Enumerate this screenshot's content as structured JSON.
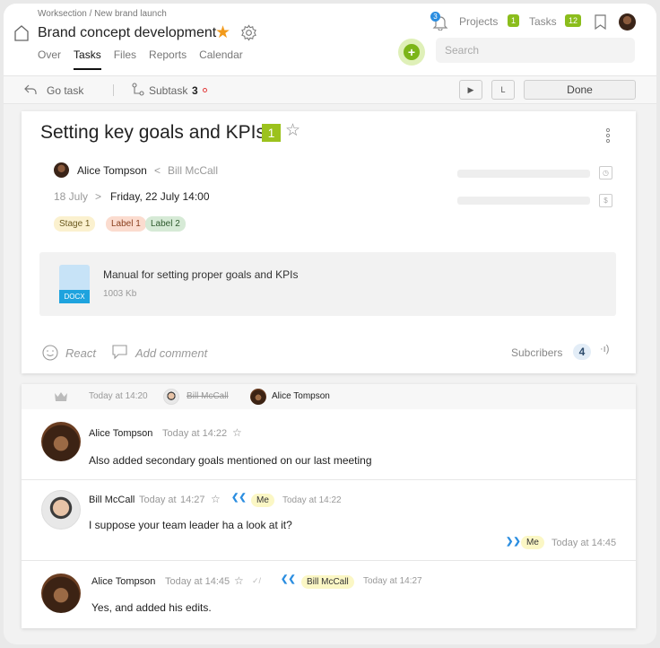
{
  "header": {
    "breadcrumb": "Worksection / New brand launch",
    "project_title": "Brand concept development",
    "nav": [
      "Over",
      "Tasks",
      "Files",
      "Reports",
      "Calendar"
    ],
    "notifications_count": "3",
    "projects_label": "Projects",
    "projects_count": "1",
    "tasks_label": "Tasks",
    "tasks_count": "12",
    "add_button": "+",
    "search_placeholder": "Search"
  },
  "toolbar": {
    "go_task": "Go task",
    "subtask_label": "Subtask",
    "subtask_count": "3",
    "play_btn": "▶",
    "l_btn": "L",
    "done": "Done"
  },
  "task": {
    "title": "Setting key goals and KPIs",
    "priority": "1",
    "assignee": "Alice Tompson",
    "lt": "<",
    "author": "Bill McCall",
    "start_date": "18 July",
    "arrow": ">",
    "end_date": "Friday, 22 July 14:00",
    "tags": [
      "Stage 1",
      "Label 1",
      "Label 2"
    ],
    "clock_glyph": "◷",
    "dollar_glyph": "$",
    "file": {
      "type": "DOCX",
      "name": "Manual for setting proper goals and KPIs",
      "size": "1003 Kb"
    },
    "react": "React",
    "add_comment": "Add comment",
    "subscribers_label": "Subcribers",
    "subscribers_count": "4",
    "sound_glyph": "·ı)"
  },
  "history": {
    "time": "Today at 14:20",
    "from": "Bill McCall",
    "to": "Alice Tompson"
  },
  "comments": [
    {
      "name": "Alice Tompson",
      "time": "Today at 14:22",
      "text": "Also added secondary goals mentioned on our last meeting"
    },
    {
      "name": "Bill McCall",
      "time": "Today at",
      "time2": "14:27",
      "reply_to": "Me",
      "reply_time": "Today at 14:22",
      "text": "I suppose your team leader ha a look at it?",
      "answer_by": "Me",
      "answer_time": "Today at 14:45"
    },
    {
      "name": "Alice Tompson",
      "time": "Today at 14:45",
      "read_mark": "✓/",
      "reply_to": "Bill McCall",
      "reply_time": "Today at 14:27",
      "text": "Yes, and added his edits."
    }
  ],
  "glyphs": {
    "star_filled": "★",
    "star_outline": "☆",
    "chev_left": "❮❮",
    "chev_right": "❯❯"
  }
}
